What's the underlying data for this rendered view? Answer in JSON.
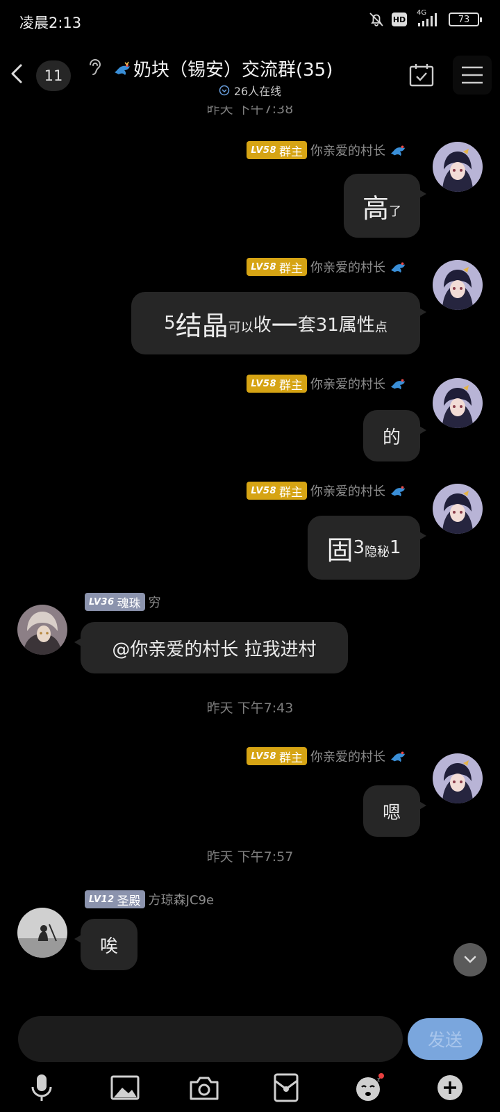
{
  "status": {
    "time": "凌晨2:13",
    "network": "4G",
    "hd": "HD",
    "battery": "73"
  },
  "header": {
    "unread_count": "11",
    "group_title": "奶块（锡安）交流群(35)",
    "online": "26人在线"
  },
  "timestamps": {
    "top_partial": "昨天 下午7:38",
    "t1": "昨天 下午7:43",
    "t2": "昨天 下午7:57"
  },
  "users": {
    "owner": {
      "level": "LV58",
      "title": "群主",
      "name": "你亲爱的村长"
    },
    "soul": {
      "level": "LV36",
      "title": "魂珠",
      "name": "穷"
    },
    "holy": {
      "level": "LV12",
      "title": "圣殿",
      "name": "方琼森JC9e"
    }
  },
  "messages": {
    "m1": {
      "a": "高",
      "b": "了"
    },
    "m2": {
      "a": "5",
      "b": "结晶",
      "c": "可以",
      "d": "收",
      "e": "一",
      "f": "套31属性",
      "g": "点"
    },
    "m3": {
      "a": "的"
    },
    "m4": {
      "a": "固",
      "b": "3",
      "c": "隐秘",
      "d": "1"
    },
    "m5": {
      "a": "@你亲爱的村长 拉我进村"
    },
    "m6": {
      "a": "嗯"
    },
    "m7": {
      "a": "唉"
    }
  },
  "input": {
    "send_label": "发送"
  },
  "toolbar": {
    "icons": [
      "microphone-icon",
      "image-icon",
      "camera-icon",
      "red-packet-icon",
      "emoji-icon",
      "plus-icon"
    ]
  },
  "colors": {
    "bubble": "#262626",
    "owner_badge": "#d6a414",
    "member_badge": "#8b93ad",
    "send": "#7aa6dd"
  }
}
